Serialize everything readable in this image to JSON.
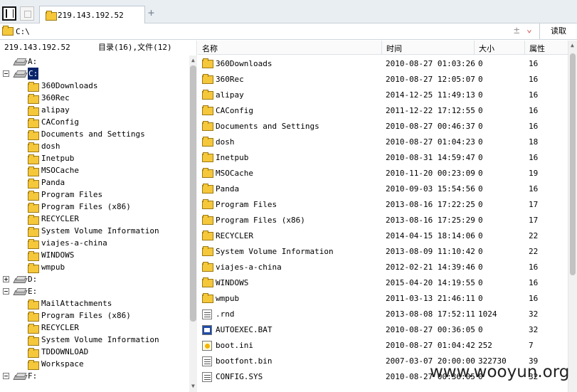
{
  "tab": {
    "title": "219.143.192.52"
  },
  "address": {
    "path": "C:\\",
    "read_label": "读取"
  },
  "left_panel": {
    "host": "219.143.192.52",
    "summary": "目录(16),文件(12)"
  },
  "tree": {
    "a": "A:",
    "c": "C:",
    "c_children": [
      "360Downloads",
      "360Rec",
      "alipay",
      "CAConfig",
      "Documents and Settings",
      "dosh",
      "Inetpub",
      "MSOCache",
      "Panda",
      "Program Files",
      "Program Files (x86)",
      "RECYCLER",
      "System Volume Information",
      "viajes-a-china",
      "WINDOWS",
      "wmpub"
    ],
    "d": "D:",
    "e": "E:",
    "e_children": [
      "MailAttachments",
      "Program Files (x86)",
      "RECYCLER",
      "System Volume Information",
      "TDDOWNLOAD",
      "Workspace"
    ],
    "f": "F:"
  },
  "table": {
    "headers": {
      "name": "名称",
      "time": "时间",
      "size": "大小",
      "attr": "属性"
    },
    "rows": [
      {
        "name": "360Downloads",
        "time": "2010-08-27 01:03:26",
        "size": "0",
        "attr": "16",
        "type": "folder"
      },
      {
        "name": "360Rec",
        "time": "2010-08-27 12:05:07",
        "size": "0",
        "attr": "16",
        "type": "folder"
      },
      {
        "name": "alipay",
        "time": "2014-12-25 11:49:13",
        "size": "0",
        "attr": "16",
        "type": "folder"
      },
      {
        "name": "CAConfig",
        "time": "2011-12-22 17:12:55",
        "size": "0",
        "attr": "16",
        "type": "folder"
      },
      {
        "name": "Documents and Settings",
        "time": "2010-08-27 00:46:37",
        "size": "0",
        "attr": "16",
        "type": "folder"
      },
      {
        "name": "dosh",
        "time": "2010-08-27 01:04:23",
        "size": "0",
        "attr": "18",
        "type": "folder"
      },
      {
        "name": "Inetpub",
        "time": "2010-08-31 14:59:47",
        "size": "0",
        "attr": "16",
        "type": "folder"
      },
      {
        "name": "MSOCache",
        "time": "2010-11-20 00:23:09",
        "size": "0",
        "attr": "19",
        "type": "folder"
      },
      {
        "name": "Panda",
        "time": "2010-09-03 15:54:56",
        "size": "0",
        "attr": "16",
        "type": "folder"
      },
      {
        "name": "Program Files",
        "time": "2013-08-16 17:22:25",
        "size": "0",
        "attr": "17",
        "type": "folder"
      },
      {
        "name": "Program Files (x86)",
        "time": "2013-08-16 17:25:29",
        "size": "0",
        "attr": "17",
        "type": "folder"
      },
      {
        "name": "RECYCLER",
        "time": "2014-04-15 18:14:06",
        "size": "0",
        "attr": "22",
        "type": "folder"
      },
      {
        "name": "System Volume Information",
        "time": "2013-08-09 11:10:42",
        "size": "0",
        "attr": "22",
        "type": "folder"
      },
      {
        "name": "viajes-a-china",
        "time": "2012-02-21 14:39:46",
        "size": "0",
        "attr": "16",
        "type": "folder"
      },
      {
        "name": "WINDOWS",
        "time": "2015-04-20 14:19:55",
        "size": "0",
        "attr": "16",
        "type": "folder"
      },
      {
        "name": "wmpub",
        "time": "2011-03-13 21:46:11",
        "size": "0",
        "attr": "16",
        "type": "folder"
      },
      {
        "name": ".rnd",
        "time": "2013-08-08 17:52:11",
        "size": "1024",
        "attr": "32",
        "type": "sys"
      },
      {
        "name": "AUTOEXEC.BAT",
        "time": "2010-08-27 00:36:05",
        "size": "0",
        "attr": "32",
        "type": "bat"
      },
      {
        "name": "boot.ini",
        "time": "2010-08-27 01:04:42",
        "size": "252",
        "attr": "7",
        "type": "ini"
      },
      {
        "name": "bootfont.bin",
        "time": "2007-03-07 20:00:00",
        "size": "322730",
        "attr": "39",
        "type": "sys"
      },
      {
        "name": "CONFIG.SYS",
        "time": "2010-08-27 00:36:05",
        "size": "0",
        "attr": "32",
        "type": "sys"
      }
    ]
  },
  "watermark": "www.wooyun.org"
}
